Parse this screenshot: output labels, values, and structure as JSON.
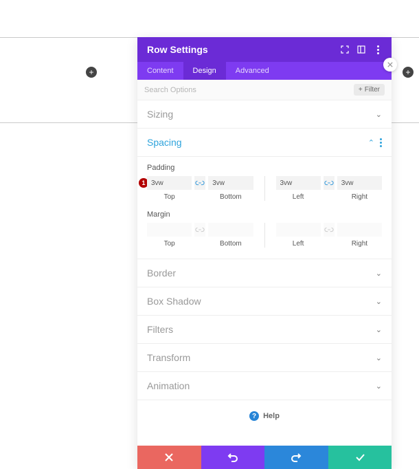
{
  "canvas": {
    "plus_left": "+",
    "plus_right": "+"
  },
  "modal": {
    "title": "Row Settings",
    "tabs": {
      "content": "Content",
      "design": "Design",
      "advanced": "Advanced",
      "active": "design"
    },
    "search": {
      "placeholder": "Search Options",
      "filter_label": "Filter",
      "filter_plus": "+"
    },
    "sections": {
      "sizing": "Sizing",
      "spacing": "Spacing",
      "border": "Border",
      "box_shadow": "Box Shadow",
      "filters": "Filters",
      "transform": "Transform",
      "animation": "Animation"
    },
    "spacing": {
      "padding_label": "Padding",
      "margin_label": "Margin",
      "padding": {
        "top": "3vw",
        "bottom": "3vw",
        "left": "3vw",
        "right": "3vw"
      },
      "margin": {
        "top": "",
        "bottom": "",
        "left": "",
        "right": ""
      },
      "sublabels": {
        "top": "Top",
        "bottom": "Bottom",
        "left": "Left",
        "right": "Right"
      }
    },
    "annotation_badge": "1",
    "help": "Help"
  }
}
